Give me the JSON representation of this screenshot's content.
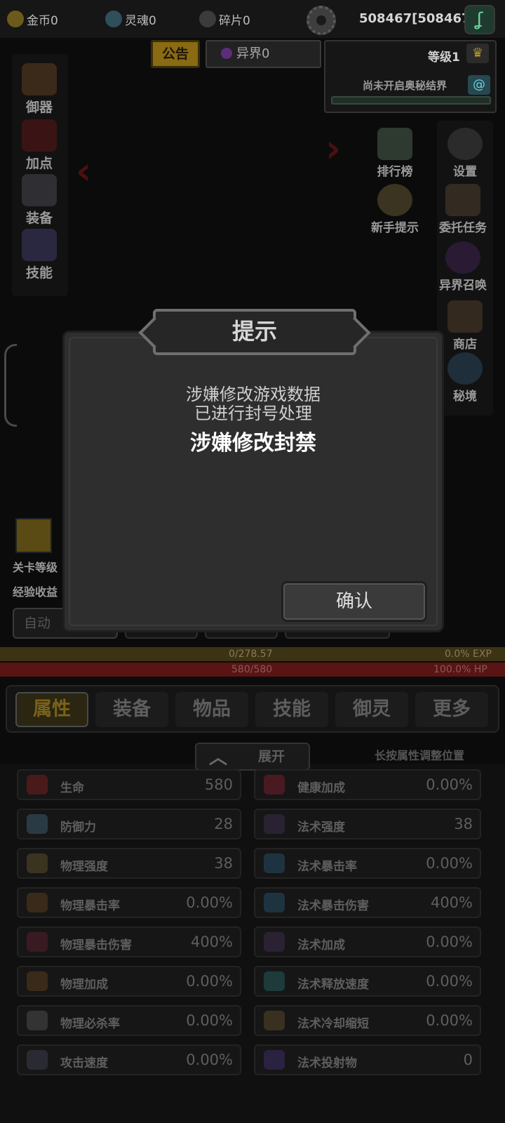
{
  "top": {
    "gold": "金币0",
    "soul": "灵魂0",
    "fragment": "碎片0",
    "player_id": "508467[508467]"
  },
  "tabs_top": {
    "notice": "公告",
    "otherworld": "异界0"
  },
  "level": {
    "label": "等级1",
    "mystic": "尚未开启奥秘结界"
  },
  "left_menu": [
    "御器",
    "加点",
    "装备",
    "技能"
  ],
  "right_menu": {
    "ranking": "排行榜",
    "settings": "设置",
    "novice_tips": "新手提示",
    "commission": "委托任务",
    "summon": "异界召唤",
    "shop": "商店",
    "secret_realm": "秘境"
  },
  "stage": {
    "level_label": "关卡等级",
    "exp_label": "经验收益",
    "auto_button": "自动"
  },
  "bars": {
    "exp_value": "0/278.57",
    "exp_percent": "0.0% EXP",
    "hp_value": "580/580",
    "hp_percent": "100.0% HP"
  },
  "bottom_tabs": [
    "属性",
    "装备",
    "物品",
    "技能",
    "御灵",
    "更多"
  ],
  "expand": {
    "label": "展开",
    "hint": "长按属性调整位置"
  },
  "attributes_left": [
    {
      "name": "生命",
      "value": "580"
    },
    {
      "name": "防御力",
      "value": "28"
    },
    {
      "name": "物理强度",
      "value": "38"
    },
    {
      "name": "物理暴击率",
      "value": "0.00%"
    },
    {
      "name": "物理暴击伤害",
      "value": "400%"
    },
    {
      "name": "物理加成",
      "value": "0.00%"
    },
    {
      "name": "物理必杀率",
      "value": "0.00%"
    },
    {
      "name": "攻击速度",
      "value": "0.00%"
    }
  ],
  "attributes_right": [
    {
      "name": "健康加成",
      "value": "0.00%"
    },
    {
      "name": "法术强度",
      "value": "38"
    },
    {
      "name": "法术暴击率",
      "value": "0.00%"
    },
    {
      "name": "法术暴击伤害",
      "value": "400%"
    },
    {
      "name": "法术加成",
      "value": "0.00%"
    },
    {
      "name": "法术释放速度",
      "value": "0.00%"
    },
    {
      "name": "法术冷却缩短",
      "value": "0.00%"
    },
    {
      "name": "法术投射物",
      "value": "0"
    }
  ],
  "dialog": {
    "title": "提示",
    "line1": "涉嫌修改游戏数据",
    "line2": "已进行封号处理",
    "reason": "涉嫌修改封禁",
    "confirm": "确认"
  },
  "colors": {
    "accent_gold": "#8a6a12",
    "hp_red": "#5a1414",
    "exp_bar": "#3b3314",
    "dialog_bg": "#2e2e2e"
  }
}
